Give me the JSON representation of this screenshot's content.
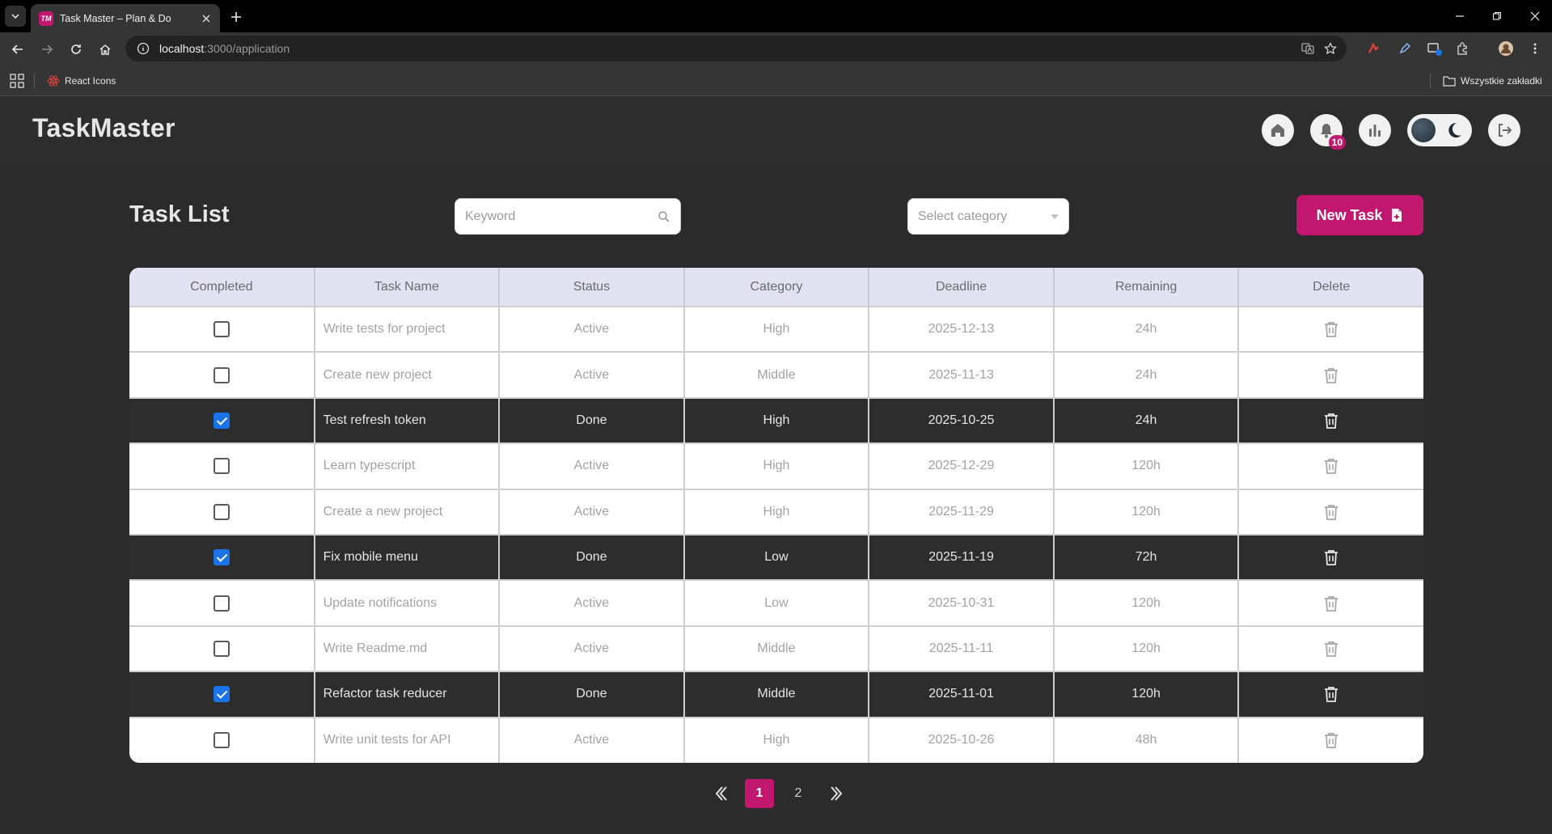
{
  "browser": {
    "tab_title": "Task Master – Plan & Do",
    "favicon_text": "TM",
    "url_host": "localhost",
    "url_path": ":3000/application",
    "bookmarks": [
      {
        "label": "React Icons",
        "icon": "react-icon"
      }
    ],
    "all_bookmarks_label": "Wszystkie zakładki"
  },
  "app": {
    "logo": "TaskMaster",
    "notification_count": "10",
    "header_icons": [
      "home-icon",
      "bell-icon",
      "chart-icon",
      "theme-toggle",
      "logout-icon"
    ]
  },
  "page": {
    "title": "Task List",
    "search_placeholder": "Keyword",
    "category_placeholder": "Select category",
    "new_task_label": "New Task"
  },
  "table": {
    "headers": [
      "Completed",
      "Task Name",
      "Status",
      "Category",
      "Deadline",
      "Remaining",
      "Delete"
    ],
    "rows": [
      {
        "completed": false,
        "name": "Write tests for project",
        "status": "Active",
        "category": "High",
        "deadline": "2025-12-13",
        "remaining": "24h"
      },
      {
        "completed": false,
        "name": "Create new project",
        "status": "Active",
        "category": "Middle",
        "deadline": "2025-11-13",
        "remaining": "24h"
      },
      {
        "completed": true,
        "name": "Test refresh token",
        "status": "Done",
        "category": "High",
        "deadline": "2025-10-25",
        "remaining": "24h"
      },
      {
        "completed": false,
        "name": "Learn typescript",
        "status": "Active",
        "category": "High",
        "deadline": "2025-12-29",
        "remaining": "120h"
      },
      {
        "completed": false,
        "name": "Create a new project",
        "status": "Active",
        "category": "High",
        "deadline": "2025-11-29",
        "remaining": "120h"
      },
      {
        "completed": true,
        "name": "Fix mobile menu",
        "status": "Done",
        "category": "Low",
        "deadline": "2025-11-19",
        "remaining": "72h"
      },
      {
        "completed": false,
        "name": "Update notifications",
        "status": "Active",
        "category": "Low",
        "deadline": "2025-10-31",
        "remaining": "120h"
      },
      {
        "completed": false,
        "name": "Write Readme.md",
        "status": "Active",
        "category": "Middle",
        "deadline": "2025-11-11",
        "remaining": "120h"
      },
      {
        "completed": true,
        "name": "Refactor task reducer",
        "status": "Done",
        "category": "Middle",
        "deadline": "2025-11-01",
        "remaining": "120h"
      },
      {
        "completed": false,
        "name": "Write unit tests for API",
        "status": "Active",
        "category": "High",
        "deadline": "2025-10-26",
        "remaining": "48h"
      }
    ]
  },
  "pagination": {
    "pages": [
      "1",
      "2"
    ],
    "current": "1"
  },
  "colors": {
    "accent": "#c2176f",
    "background": "#2b2b2b",
    "table_header": "#e3e2f2",
    "done_row": "#2d2d2d",
    "checkbox_checked": "#1a73e8"
  }
}
